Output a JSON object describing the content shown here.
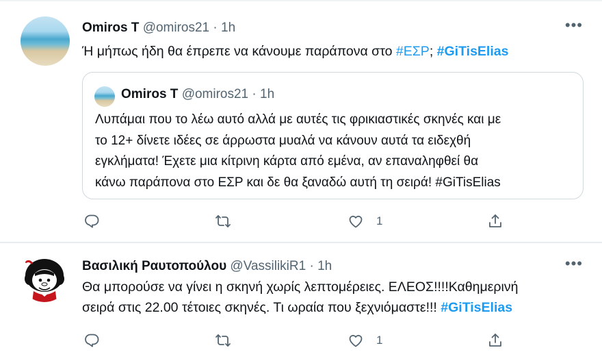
{
  "tweets": [
    {
      "name": "Omiros T",
      "handle": "@omiros21",
      "sep": " · ",
      "time": "1h",
      "more": "•••",
      "text_before": "Ή μήπως ήδη θα έπρεπε να κάνουμε παράπονα στο ",
      "tag1": "#ΕΣΡ",
      "text_mid": "; ",
      "tag2": "#GiTisElias",
      "quote": {
        "name": "Omiros T",
        "handle": "@omiros21",
        "sep": " · ",
        "time": "1h",
        "lines": [
          "Λυπάμαι που το λέω αυτό αλλά με αυτές τις φρικιαστικές σκηνές και με",
          "το 12+ δίνετε ιδέες σε άρρωστα μυαλά να κάνουν αυτά τα ειδεχθή",
          "εγκλήματα! Έχετε μια κίτρινη κάρτα από εμένα, αν επαναληφθεί θα",
          "κάνω παράπονα στο ΕΣΡ και δε θα ξαναδώ αυτή τη σειρά! #GiTisElias"
        ]
      },
      "like_count": "1",
      "avatar": "beach-avatar"
    },
    {
      "name": "Βασιλική Ραυτοπούλου",
      "handle": "@VassilikiR1",
      "sep": " · ",
      "time": "1h",
      "more": "•••",
      "line1": "Θα μπορούσε να γίνει η σκηνή χωρίς λεπτομέρειες. ΕΛΕΟΣ!!!!Καθημερινή",
      "line2_before": "σειρά στις 22.00 τέτοιες  σκηνές. Τι ωραία που ξεχνιόμαστε!!! ",
      "tag": "#GiTisElias",
      "like_count": "1",
      "avatar": "mafalda-avatar"
    }
  ],
  "icons": {
    "reply": "reply-icon",
    "retweet": "retweet-icon",
    "like": "heart-icon",
    "share": "share-icon",
    "more": "more-icon"
  },
  "colors": {
    "link": "#1d9bf0",
    "muted": "#536471",
    "text": "#0f1419",
    "border": "#cfd9de"
  }
}
